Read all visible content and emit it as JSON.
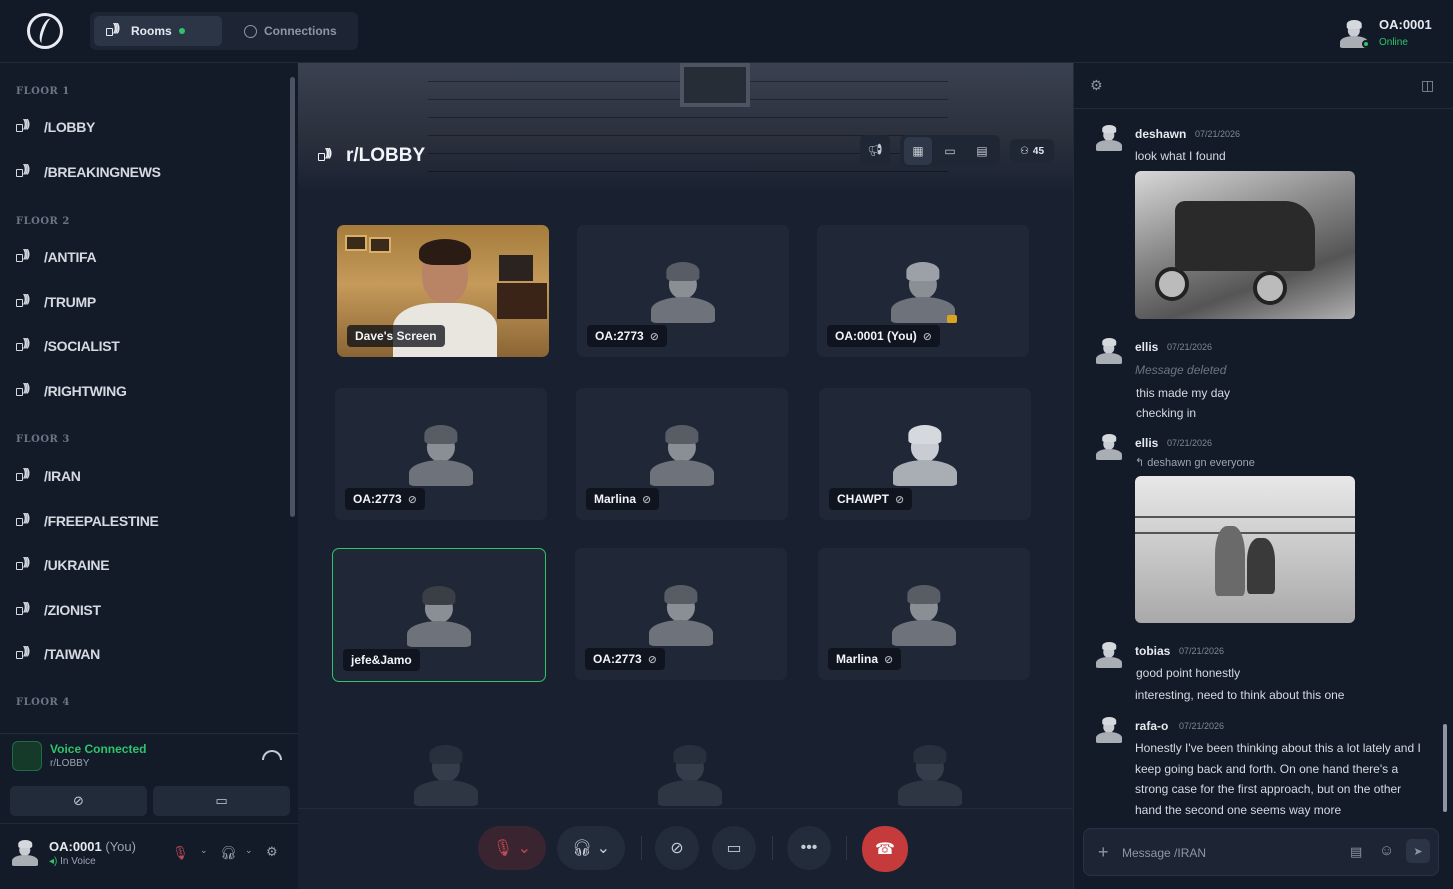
{
  "topbar": {
    "tabs": [
      {
        "label": "Rooms",
        "active": true
      },
      {
        "label": "Connections",
        "active": false
      }
    ],
    "user": {
      "name": "OA:0001",
      "status": "Online"
    }
  },
  "sidebar": {
    "floors": [
      {
        "label": "FLOOR 1",
        "rooms": [
          "/LOBBY",
          "/BREAKINGNEWS"
        ]
      },
      {
        "label": "FLOOR 2",
        "rooms": [
          "/ANTIFA",
          "/TRUMP",
          "/SOCIALIST",
          "/RIGHTWING"
        ]
      },
      {
        "label": "FLOOR 3",
        "rooms": [
          "/IRAN",
          "/FREEPALESTINE",
          "/UKRAINE",
          "/ZIONIST",
          "/TAIWAN"
        ]
      },
      {
        "label": "FLOOR 4",
        "rooms": []
      }
    ],
    "voice": {
      "title": "Voice Connected",
      "room": "r/LOBBY"
    },
    "me": {
      "name": "OA:0001",
      "you": "(You)",
      "status": "In Voice"
    }
  },
  "main": {
    "room_title": "r/LOBBY",
    "participant_count": "45",
    "tiles": [
      {
        "label": "Dave's Screen",
        "type": "screen"
      },
      {
        "label": "OA:2773",
        "muted": true
      },
      {
        "label": "OA:0001 (You)",
        "muted": true,
        "crown": true
      },
      {
        "label": "OA:2773",
        "muted": true
      },
      {
        "label": "Marlina",
        "muted": true
      },
      {
        "label": "CHAWPT",
        "muted": true
      },
      {
        "label": "jefe&Jamo",
        "speaking": true
      },
      {
        "label": "OA:2773",
        "muted": true
      },
      {
        "label": "Marlina",
        "muted": true
      }
    ]
  },
  "chat": {
    "messages": [
      {
        "user": "deshawn",
        "date": "07/21/2026",
        "lines": [
          "look what I found"
        ]
      },
      {
        "user": "ellis",
        "date": "07/21/2026",
        "deleted": "Message deleted",
        "lines": [
          "this made my day",
          "checking in"
        ]
      },
      {
        "user": "ellis",
        "date": "07/21/2026",
        "reply": "deshawn gn everyone"
      },
      {
        "user": "tobias",
        "date": "07/21/2026",
        "lines": [
          "good point honestly",
          "interesting, need to think about this one"
        ]
      },
      {
        "user": "rafa-o",
        "date": "07/21/2026",
        "long": "Honestly I've been thinking about this a lot lately and I keep going back and forth. On one hand there's a strong case for the first approach, but on the other hand the second one seems way more"
      }
    ],
    "input_placeholder": "Message /IRAN"
  },
  "colors": {
    "accent_green": "#2ec46b",
    "hangup_red": "#c53a3a",
    "bg": "#141b28"
  }
}
